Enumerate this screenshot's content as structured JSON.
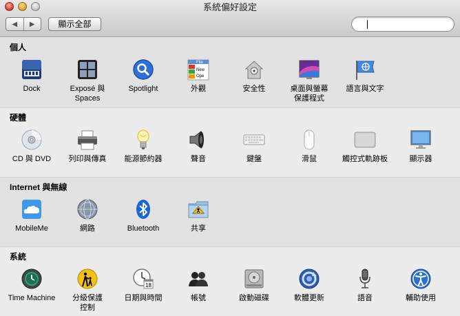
{
  "window": {
    "title": "系統偏好設定",
    "show_all_label": "顯示全部",
    "back_glyph": "◀",
    "forward_glyph": "▶",
    "search_placeholder": ""
  },
  "sections": [
    {
      "title": "個人",
      "items": [
        {
          "label": "Dock",
          "icon": "dock-icon"
        },
        {
          "label": "Exposé 與\nSpaces",
          "icon": "expose-spaces-icon"
        },
        {
          "label": "Spotlight",
          "icon": "spotlight-icon"
        },
        {
          "label": "外觀",
          "icon": "appearance-icon"
        },
        {
          "label": "安全性",
          "icon": "security-icon"
        },
        {
          "label": "桌面與螢幕\n保護程式",
          "icon": "desktop-screensaver-icon"
        },
        {
          "label": "語言與文字",
          "icon": "language-text-icon"
        }
      ]
    },
    {
      "title": "硬體",
      "items": [
        {
          "label": "CD 與 DVD",
          "icon": "cd-dvd-icon"
        },
        {
          "label": "列印與傳真",
          "icon": "print-fax-icon"
        },
        {
          "label": "能源節約器",
          "icon": "energy-saver-icon"
        },
        {
          "label": "聲音",
          "icon": "sound-icon"
        },
        {
          "label": "鍵盤",
          "icon": "keyboard-icon"
        },
        {
          "label": "滑鼠",
          "icon": "mouse-icon"
        },
        {
          "label": "觸控式軌跡板",
          "icon": "trackpad-icon"
        },
        {
          "label": "顯示器",
          "icon": "displays-icon"
        }
      ]
    },
    {
      "title": "Internet 與無線",
      "items": [
        {
          "label": "MobileMe",
          "icon": "mobileme-icon"
        },
        {
          "label": "網路",
          "icon": "network-icon"
        },
        {
          "label": "Bluetooth",
          "icon": "bluetooth-icon"
        },
        {
          "label": "共享",
          "icon": "sharing-icon"
        }
      ]
    },
    {
      "title": "系統",
      "items": [
        {
          "label": "Time Machine",
          "icon": "time-machine-icon"
        },
        {
          "label": "分級保護\n控制",
          "icon": "parental-controls-icon"
        },
        {
          "label": "日期與時間",
          "icon": "date-time-icon"
        },
        {
          "label": "帳號",
          "icon": "accounts-icon"
        },
        {
          "label": "啟動磁碟",
          "icon": "startup-disk-icon"
        },
        {
          "label": "軟體更新",
          "icon": "software-update-icon"
        },
        {
          "label": "語音",
          "icon": "speech-icon"
        },
        {
          "label": "輔助使用",
          "icon": "universal-access-icon"
        }
      ]
    }
  ],
  "icon_texts": {
    "appearance_lines": [
      "File",
      "New",
      "Ope"
    ],
    "calendar_day": "18"
  },
  "colors": {
    "spotlight_blue": "#2f6fd6",
    "bluetooth_blue": "#1a63d8",
    "parental_yellow": "#f2c21b",
    "universal_access_blue": "#2b6fd1",
    "mobileme_blue": "#3e9ae6"
  }
}
